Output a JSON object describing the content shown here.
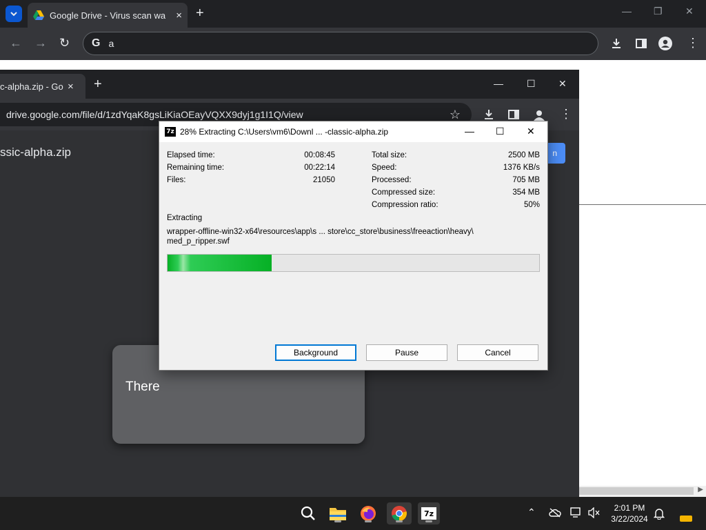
{
  "outer_browser": {
    "tab_title": "Google Drive - Virus scan warni",
    "address": "a",
    "new_tab": "+",
    "tab_close": "×",
    "google_glyph": "G"
  },
  "inner_browser": {
    "tab_title": "c-alpha.zip - Goo",
    "tab_close": "×",
    "new_tab": "+",
    "url": "drive.google.com/file/d/1zdYqaK8gsLiKiaOEayVQXX9dyj1g1I1Q/view",
    "file_title": "ssic-alpha.zip",
    "partial_button": "n",
    "card_text": "There"
  },
  "dialog": {
    "icon_label": "7z",
    "title": "28% Extracting C:\\Users\\vm6\\Downl ... -classic-alpha.zip",
    "left_stats": [
      {
        "label": "Elapsed time:",
        "value": "00:08:45"
      },
      {
        "label": "Remaining time:",
        "value": "00:22:14"
      },
      {
        "label": "Files:",
        "value": "21050"
      }
    ],
    "right_stats": [
      {
        "label": "Total size:",
        "value": "2500 MB"
      },
      {
        "label": "Speed:",
        "value": "1376 KB/s"
      },
      {
        "label": "Processed:",
        "value": "705 MB"
      },
      {
        "label": "Compressed size:",
        "value": "354 MB"
      },
      {
        "label": "Compression ratio:",
        "value": "50%"
      }
    ],
    "status": "Extracting",
    "path_line1": "wrapper-offline-win32-x64\\resources\\app\\s ... store\\cc_store\\business\\freeaction\\heavy\\",
    "path_line2": "med_p_ripper.swf",
    "progress": 0.28,
    "buttons": {
      "background": "Background",
      "pause": "Pause",
      "cancel": "Cancel"
    }
  },
  "taskbar": {
    "time": "2:01 PM",
    "date": "3/22/2024",
    "app_7z_label": "7z"
  },
  "colors": {
    "progress_green": "#06b025",
    "drive_blue": "#4c8df6",
    "chrome_dark": "#202124"
  }
}
